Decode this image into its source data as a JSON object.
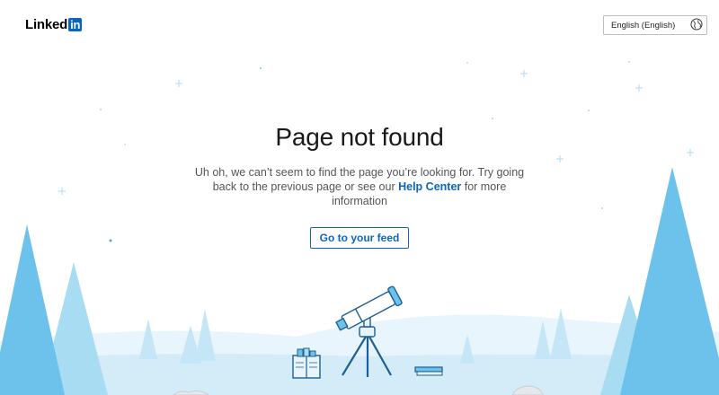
{
  "header": {
    "logo_text": "Linked",
    "logo_badge": "in",
    "language_label": "English (English)",
    "language_icon": "globe-icon"
  },
  "main": {
    "title": "Page not found",
    "message_before": "Uh oh, we can’t seem to find the page you’re looking for. Try going back to the previous page or see our ",
    "help_link": "Help Center",
    "message_after": " for more information",
    "feed_button": "Go to your feed"
  },
  "colors": {
    "brand": "#0a66c2",
    "tree_light": "#a8dcf2",
    "tree_dark": "#5fbbe6",
    "ground": "#d7eefa"
  }
}
